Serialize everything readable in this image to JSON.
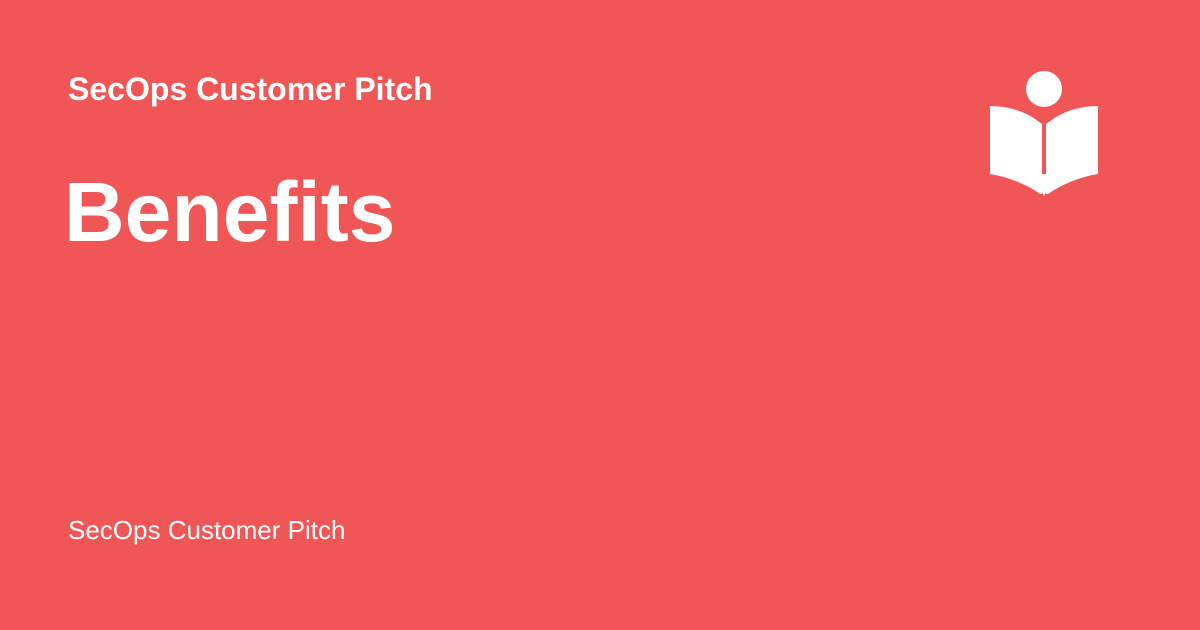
{
  "brand": {
    "background_color": "#ef5655",
    "foreground_color": "#ffffff",
    "logo_icon": "reader-book-icon"
  },
  "header": {
    "subtitle": "SecOps Customer Pitch"
  },
  "main": {
    "title": "Benefits"
  },
  "footer": {
    "label": "SecOps Customer Pitch"
  }
}
